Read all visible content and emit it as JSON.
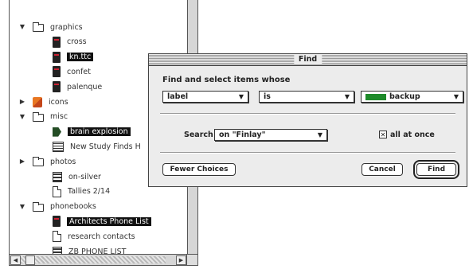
{
  "finder": {
    "items": [
      {
        "label": "graphics",
        "icon": "folder-icon",
        "disclosure": "open"
      },
      {
        "label": "cross",
        "icon": "app-icon"
      },
      {
        "label": "kn.ttc",
        "icon": "app-icon",
        "selected": true
      },
      {
        "label": "confet",
        "icon": "app-icon"
      },
      {
        "label": "palenque",
        "icon": "app-icon"
      },
      {
        "label": "icons",
        "icon": "flag-icon",
        "disclosure": "closed"
      },
      {
        "label": "misc",
        "icon": "folder-icon",
        "disclosure": "open"
      },
      {
        "label": "brain explosion",
        "icon": "green-doc-icon",
        "selected": true
      },
      {
        "label": "New Study Finds H",
        "icon": "picture-icon"
      },
      {
        "label": "photos",
        "icon": "folder-icon",
        "disclosure": "closed"
      },
      {
        "label": "on-silver",
        "icon": "stack-icon"
      },
      {
        "label": "Tallies 2/14",
        "icon": "document-icon"
      },
      {
        "label": "phonebooks",
        "icon": "folder-icon",
        "disclosure": "open"
      },
      {
        "label": "Architects Phone List",
        "icon": "app-icon",
        "selected": true
      },
      {
        "label": "research contacts",
        "icon": "document-icon"
      },
      {
        "label": "ZB PHONE LIST",
        "icon": "stack-icon"
      }
    ]
  },
  "dialog": {
    "title": "Find",
    "heading": "Find and select items whose",
    "criteria": {
      "attribute": "label",
      "operator": "is",
      "value": "backup",
      "value_color": "#1e8a2a"
    },
    "search_label": "Search",
    "search_scope": "on \"Finlay\"",
    "all_at_once_label": "all at once",
    "all_at_once_checked": true,
    "buttons": {
      "fewer": "Fewer Choices",
      "cancel": "Cancel",
      "find": "Find"
    }
  }
}
